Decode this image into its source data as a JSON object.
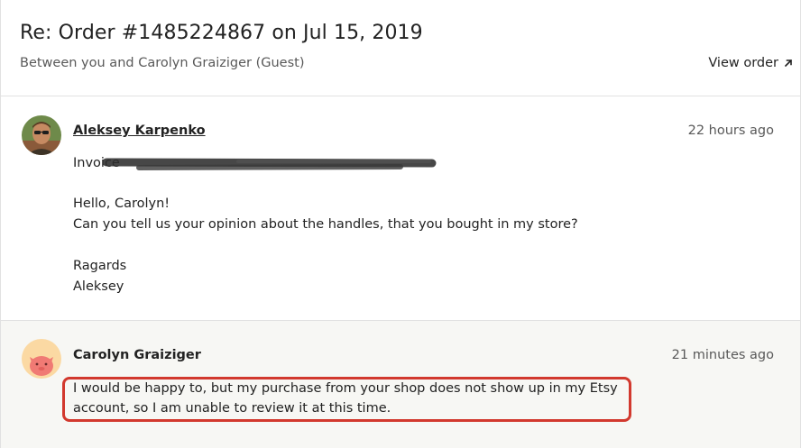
{
  "header": {
    "title": "Re: Order #1485224867 on Jul 15, 2019",
    "subtitle": "Between you and Carolyn Graiziger (Guest)",
    "view_order_label": "View order"
  },
  "messages": [
    {
      "sender": "Aleksey Karpenko",
      "time": "22 hours ago",
      "invoice_prefix": "Invoice",
      "lines": [
        "Hello, Carolyn!",
        "Can you tell us your opinion about the handles, that you bought in my store?",
        "Ragards",
        "Aleksey"
      ]
    },
    {
      "sender": "Carolyn Graiziger",
      "time": "21 minutes ago",
      "lines": [
        "I would be happy to, but my purchase from your shop does not show up in my Etsy",
        "account, so I am unable to review it at this time."
      ]
    }
  ],
  "colors": {
    "highlight": "#d2392e",
    "reply_background": "#f7f7f4",
    "divider": "#e1e1e1"
  }
}
